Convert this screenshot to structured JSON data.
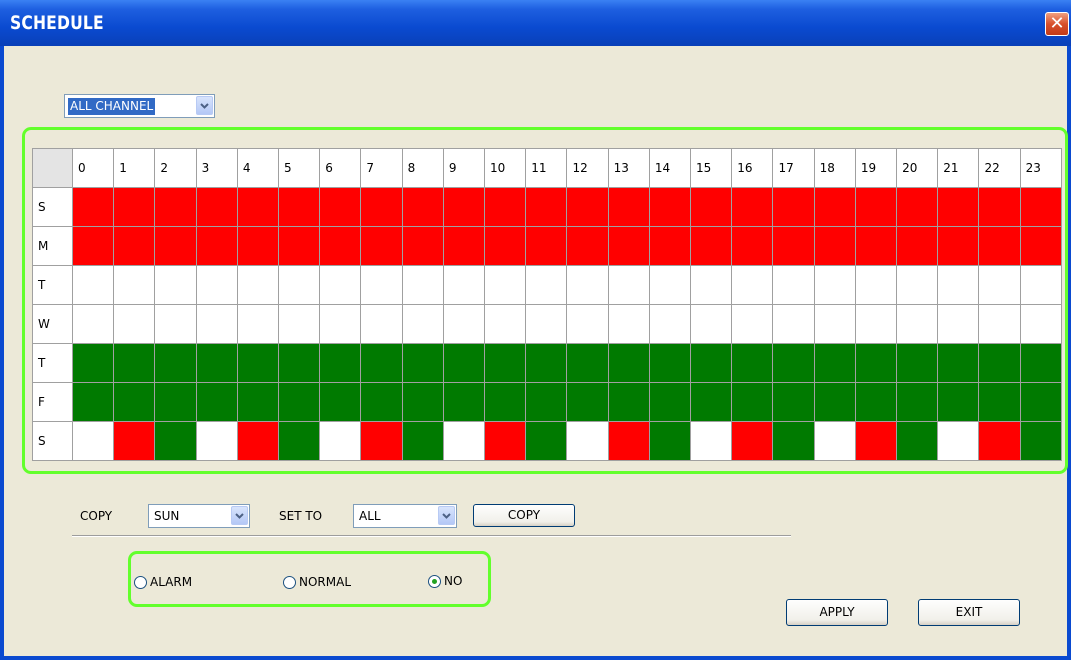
{
  "window": {
    "title": "SCHEDULE",
    "close_glyph": "✕"
  },
  "channel": {
    "selected": "ALL CHANNEL"
  },
  "grid": {
    "hours": [
      "0",
      "1",
      "2",
      "3",
      "4",
      "5",
      "6",
      "7",
      "8",
      "9",
      "10",
      "11",
      "12",
      "13",
      "14",
      "15",
      "16",
      "17",
      "18",
      "19",
      "20",
      "21",
      "22",
      "23"
    ],
    "days": [
      "S",
      "M",
      "T",
      "W",
      "T",
      "F",
      "S"
    ],
    "legend_colors": {
      "alarm": "#ff0000",
      "normal": "#007a00",
      "none": "#ffffff"
    },
    "rows": [
      [
        "r",
        "r",
        "r",
        "r",
        "r",
        "r",
        "r",
        "r",
        "r",
        "r",
        "r",
        "r",
        "r",
        "r",
        "r",
        "r",
        "r",
        "r",
        "r",
        "r",
        "r",
        "r",
        "r",
        "r"
      ],
      [
        "r",
        "r",
        "r",
        "r",
        "r",
        "r",
        "r",
        "r",
        "r",
        "r",
        "r",
        "r",
        "r",
        "r",
        "r",
        "r",
        "r",
        "r",
        "r",
        "r",
        "r",
        "r",
        "r",
        "r"
      ],
      [
        "w",
        "w",
        "w",
        "w",
        "w",
        "w",
        "w",
        "w",
        "w",
        "w",
        "w",
        "w",
        "w",
        "w",
        "w",
        "w",
        "w",
        "w",
        "w",
        "w",
        "w",
        "w",
        "w",
        "w"
      ],
      [
        "w",
        "w",
        "w",
        "w",
        "w",
        "w",
        "w",
        "w",
        "w",
        "w",
        "w",
        "w",
        "w",
        "w",
        "w",
        "w",
        "w",
        "w",
        "w",
        "w",
        "w",
        "w",
        "w",
        "w"
      ],
      [
        "g",
        "g",
        "g",
        "g",
        "g",
        "g",
        "g",
        "g",
        "g",
        "g",
        "g",
        "g",
        "g",
        "g",
        "g",
        "g",
        "g",
        "g",
        "g",
        "g",
        "g",
        "g",
        "g",
        "g"
      ],
      [
        "g",
        "g",
        "g",
        "g",
        "g",
        "g",
        "g",
        "g",
        "g",
        "g",
        "g",
        "g",
        "g",
        "g",
        "g",
        "g",
        "g",
        "g",
        "g",
        "g",
        "g",
        "g",
        "g",
        "g"
      ],
      [
        "w",
        "r",
        "g",
        "w",
        "r",
        "g",
        "w",
        "r",
        "g",
        "w",
        "r",
        "g",
        "w",
        "r",
        "g",
        "w",
        "r",
        "g",
        "w",
        "r",
        "g",
        "w",
        "r",
        "g"
      ]
    ]
  },
  "copy": {
    "label": "COPY",
    "from_selected": "SUN",
    "set_to_label": "SET TO",
    "to_selected": "ALL",
    "button_label": "COPY"
  },
  "mode": {
    "options": [
      {
        "label": "ALARM",
        "checked": false
      },
      {
        "label": "NORMAL",
        "checked": false
      },
      {
        "label": "NO",
        "checked": true
      }
    ]
  },
  "actions": {
    "apply_label": "APPLY",
    "exit_label": "EXIT"
  }
}
